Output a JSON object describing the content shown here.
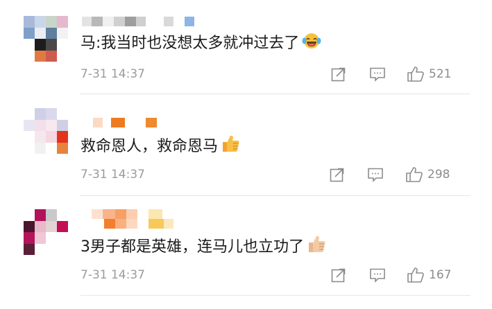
{
  "comments": [
    {
      "text": "马:我当时也没想太多就冲过去了",
      "emoji": "laughing-tears-emoji",
      "time": "7-31 14:37",
      "likes": "521",
      "avatar_colors": [
        "#a9b9dc",
        "#c9d6ea",
        "#c8d5c8",
        "#e6b8d0",
        "#7ea0c8",
        "#e9eef4",
        "#5f7f9f",
        "#f2f2f2",
        "#ffffff",
        "#1d1d1d",
        "#4a4a4a",
        "#ffffff",
        "#ffffff",
        "#e07a43",
        "#cf5a4e",
        "#ffffff"
      ]
    },
    {
      "text": "救命恩人，救命恩马",
      "emoji": "thumbs-up-emoji",
      "time": "7-31 14:37",
      "likes": "298",
      "avatar_colors": [
        "#ffffff",
        "#cfcfe8",
        "#d9d9ee",
        "#ffffff",
        "#e6e6f2",
        "#f2dfe9",
        "#f7e9ef",
        "#cfcfe5",
        "#ffffff",
        "#f4e7ee",
        "#f5d7df",
        "#e2341c",
        "#ffffff",
        "#f1f1f1",
        "#ffffff",
        "#e8833c"
      ]
    },
    {
      "text": "3男子都是英雄，连马儿也立功了",
      "emoji": "thumbs-up-emoji",
      "time": "7-31 14:37",
      "likes": "167",
      "avatar_colors": [
        "#ffffff",
        "#b3125a",
        "#c9c9c9",
        "#ffffff",
        "#4a1630",
        "#e8b9c8",
        "#e3d3d3",
        "#c40f55",
        "#b3155c",
        "#f0c7d5",
        "#ffffff",
        "#ffffff",
        "#5a1e36",
        "#ffffff",
        "#ffffff",
        "#ffffff"
      ]
    }
  ],
  "colors": {
    "time": "#9b9b9b",
    "icons": "#8c8c8c",
    "divider": "#e6e6e6"
  }
}
